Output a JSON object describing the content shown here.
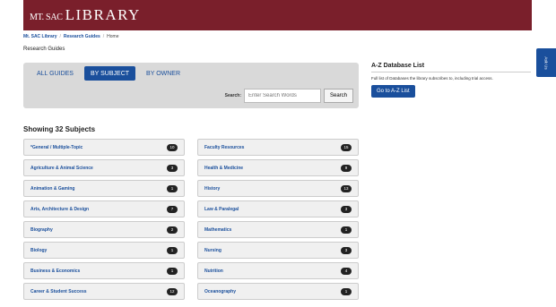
{
  "header": {
    "logo_small": "MT. SAC",
    "logo_big": "LIBRARY",
    "brand_color": "#7a1f2b"
  },
  "breadcrumb": {
    "items": [
      "Mt. SAC Library",
      "Research Guides",
      "Home"
    ],
    "separator": "/"
  },
  "page_title": "Research Guides",
  "tabs": [
    {
      "label": "ALL GUIDES",
      "active": false
    },
    {
      "label": "BY SUBJECT",
      "active": true
    },
    {
      "label": "BY OWNER",
      "active": false
    }
  ],
  "search": {
    "label": "Search:",
    "placeholder": "Enter Search Words",
    "button": "Search"
  },
  "showing": "Showing 32 Subjects",
  "subjects_left": [
    {
      "name": "*General / Multiple-Topic",
      "count": "10"
    },
    {
      "name": "Agriculture & Animal Science",
      "count": "3"
    },
    {
      "name": "Animation & Gaming",
      "count": "1"
    },
    {
      "name": "Arts, Architecture & Design",
      "count": "7"
    },
    {
      "name": "Biography",
      "count": "2"
    },
    {
      "name": "Biology",
      "count": "1"
    },
    {
      "name": "Business & Economics",
      "count": "1"
    },
    {
      "name": "Career & Student Success",
      "count": "12"
    }
  ],
  "subjects_right": [
    {
      "name": "Faculty Resources",
      "count": "15"
    },
    {
      "name": "Health & Medicine",
      "count": "9"
    },
    {
      "name": "History",
      "count": "13"
    },
    {
      "name": "Law & Paralegal",
      "count": "3"
    },
    {
      "name": "Mathematics",
      "count": "1"
    },
    {
      "name": "Nursing",
      "count": "3"
    },
    {
      "name": "Nutrition",
      "count": "4"
    },
    {
      "name": "Oceanography",
      "count": "1"
    }
  ],
  "sidebar": {
    "title": "A-Z Database List",
    "text": "Full list of Databases the library subscribes to, including trial access.",
    "button": "Go to A-Z List"
  },
  "ask_us": "Ask Us",
  "accent_color": "#1a4f9c"
}
